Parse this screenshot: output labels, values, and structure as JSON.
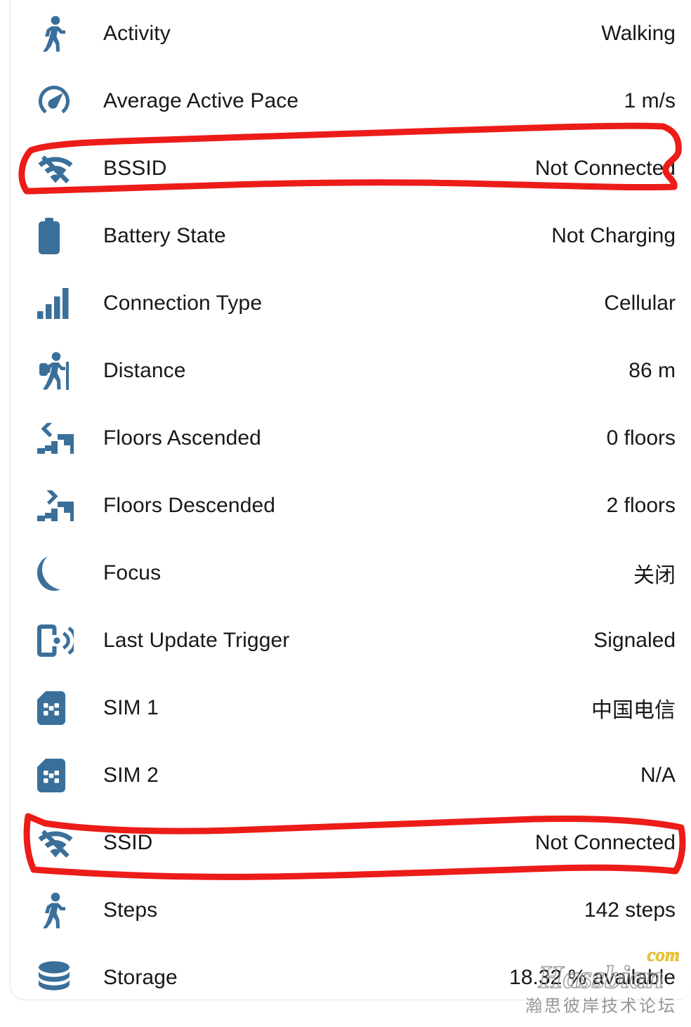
{
  "accent_icon_color": "#3a6f9a",
  "text_color": "#17181a",
  "annotation_color": "#ec1c18",
  "card": {
    "rows": [
      {
        "icon": "walking-person-icon",
        "label": "Activity",
        "value": "Walking"
      },
      {
        "icon": "speedometer-icon",
        "label": "Average Active Pace",
        "value": "1 m/s"
      },
      {
        "icon": "wifi-off-icon",
        "label": "BSSID",
        "value": "Not Connected"
      },
      {
        "icon": "battery-icon",
        "label": "Battery State",
        "value": "Not Charging"
      },
      {
        "icon": "signal-bars-icon",
        "label": "Connection Type",
        "value": "Cellular"
      },
      {
        "icon": "hiking-person-icon",
        "label": "Distance",
        "value": "86 m"
      },
      {
        "icon": "stairs-up-icon",
        "label": "Floors Ascended",
        "value": "0 floors"
      },
      {
        "icon": "stairs-down-icon",
        "label": "Floors Descended",
        "value": "2 floors"
      },
      {
        "icon": "crescent-moon-icon",
        "label": "Focus",
        "value": "关闭"
      },
      {
        "icon": "phone-signal-icon",
        "label": "Last Update Trigger",
        "value": "Signaled"
      },
      {
        "icon": "sim-card-icon",
        "label": "SIM 1",
        "value": "中国电信"
      },
      {
        "icon": "sim-card-icon",
        "label": "SIM 2",
        "value": "N/A"
      },
      {
        "icon": "wifi-off-icon",
        "label": "SSID",
        "value": "Not Connected"
      },
      {
        "icon": "walking-person-icon",
        "label": "Steps",
        "value": "142 steps"
      },
      {
        "icon": "database-icon",
        "label": "Storage",
        "value": "18.32 % available"
      }
    ]
  },
  "annotations": [
    {
      "name": "bssid-row-highlight",
      "target_label": "BSSID"
    },
    {
      "name": "ssid-row-highlight",
      "target_label": "SSID"
    }
  ],
  "watermark": {
    "brand": "Hassbian",
    "tld": "com",
    "subtitle": "瀚思彼岸技术论坛"
  }
}
